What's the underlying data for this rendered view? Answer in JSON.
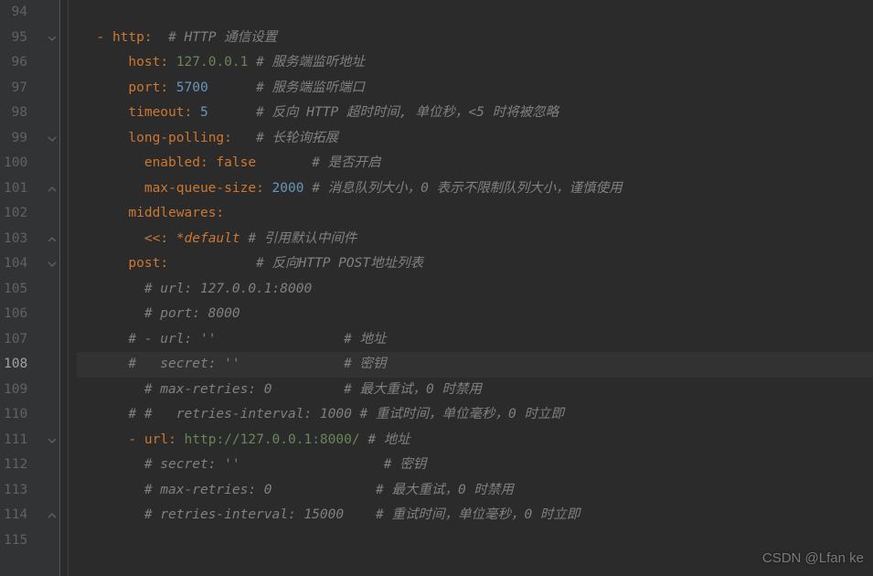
{
  "startLine": 94,
  "currentLine": 108,
  "watermark": "CSDN @Lfan ke",
  "lines": [
    {
      "num": 94,
      "tokens": []
    },
    {
      "num": 95,
      "fold": "down",
      "tokens": [
        {
          "t": "plain",
          "v": "  "
        },
        {
          "t": "dash",
          "v": "- "
        },
        {
          "t": "key",
          "v": "http"
        },
        {
          "t": "punct",
          "v": ":"
        },
        {
          "t": "plain",
          "v": "  "
        },
        {
          "t": "comment",
          "v": "# HTTP 通信设置"
        }
      ]
    },
    {
      "num": 96,
      "tokens": [
        {
          "t": "plain",
          "v": "      "
        },
        {
          "t": "key",
          "v": "host"
        },
        {
          "t": "punct",
          "v": ":"
        },
        {
          "t": "plain",
          "v": " "
        },
        {
          "t": "string",
          "v": "127.0.0.1"
        },
        {
          "t": "plain",
          "v": " "
        },
        {
          "t": "comment",
          "v": "# 服务端监听地址"
        }
      ]
    },
    {
      "num": 97,
      "tokens": [
        {
          "t": "plain",
          "v": "      "
        },
        {
          "t": "key",
          "v": "port"
        },
        {
          "t": "punct",
          "v": ":"
        },
        {
          "t": "plain",
          "v": " "
        },
        {
          "t": "number",
          "v": "5700"
        },
        {
          "t": "plain",
          "v": "      "
        },
        {
          "t": "comment",
          "v": "# 服务端监听端口"
        }
      ]
    },
    {
      "num": 98,
      "tokens": [
        {
          "t": "plain",
          "v": "      "
        },
        {
          "t": "key",
          "v": "timeout"
        },
        {
          "t": "punct",
          "v": ":"
        },
        {
          "t": "plain",
          "v": " "
        },
        {
          "t": "number",
          "v": "5"
        },
        {
          "t": "plain",
          "v": "      "
        },
        {
          "t": "comment",
          "v": "# 反向 HTTP 超时时间, 单位秒，<5 时将被忽略"
        }
      ]
    },
    {
      "num": 99,
      "fold": "down",
      "tokens": [
        {
          "t": "plain",
          "v": "      "
        },
        {
          "t": "key",
          "v": "long-polling"
        },
        {
          "t": "punct",
          "v": ":"
        },
        {
          "t": "plain",
          "v": "   "
        },
        {
          "t": "comment",
          "v": "# 长轮询拓展"
        }
      ]
    },
    {
      "num": 100,
      "tokens": [
        {
          "t": "plain",
          "v": "        "
        },
        {
          "t": "key",
          "v": "enabled"
        },
        {
          "t": "punct",
          "v": ":"
        },
        {
          "t": "plain",
          "v": " "
        },
        {
          "t": "bool",
          "v": "false"
        },
        {
          "t": "plain",
          "v": "       "
        },
        {
          "t": "comment",
          "v": "# 是否开启"
        }
      ]
    },
    {
      "num": 101,
      "fold": "up",
      "tokens": [
        {
          "t": "plain",
          "v": "        "
        },
        {
          "t": "key",
          "v": "max-queue-size"
        },
        {
          "t": "punct",
          "v": ":"
        },
        {
          "t": "plain",
          "v": " "
        },
        {
          "t": "number",
          "v": "2000"
        },
        {
          "t": "plain",
          "v": " "
        },
        {
          "t": "comment",
          "v": "# 消息队列大小，0 表示不限制队列大小，谨慎使用"
        }
      ]
    },
    {
      "num": 102,
      "tokens": [
        {
          "t": "plain",
          "v": "      "
        },
        {
          "t": "key",
          "v": "middlewares"
        },
        {
          "t": "punct",
          "v": ":"
        }
      ]
    },
    {
      "num": 103,
      "fold": "up",
      "tokens": [
        {
          "t": "plain",
          "v": "        "
        },
        {
          "t": "key",
          "v": "<<"
        },
        {
          "t": "punct",
          "v": ":"
        },
        {
          "t": "plain",
          "v": " "
        },
        {
          "t": "anchor",
          "v": "*default"
        },
        {
          "t": "plain",
          "v": " "
        },
        {
          "t": "comment",
          "v": "# 引用默认中间件"
        }
      ]
    },
    {
      "num": 104,
      "fold": "down",
      "tokens": [
        {
          "t": "plain",
          "v": "      "
        },
        {
          "t": "key",
          "v": "post"
        },
        {
          "t": "punct",
          "v": ":"
        },
        {
          "t": "plain",
          "v": "           "
        },
        {
          "t": "comment",
          "v": "# 反向HTTP POST地址列表"
        }
      ]
    },
    {
      "num": 105,
      "tokens": [
        {
          "t": "plain",
          "v": "        "
        },
        {
          "t": "comment",
          "v": "# url: 127.0.0.1:8000"
        }
      ]
    },
    {
      "num": 106,
      "tokens": [
        {
          "t": "plain",
          "v": "        "
        },
        {
          "t": "comment",
          "v": "# port: 8000"
        }
      ]
    },
    {
      "num": 107,
      "tokens": [
        {
          "t": "plain",
          "v": "      "
        },
        {
          "t": "comment",
          "v": "# - url: ''                # 地址"
        }
      ]
    },
    {
      "num": 108,
      "tokens": [
        {
          "t": "plain",
          "v": "      "
        },
        {
          "t": "comment",
          "v": "#   secret: ''             # 密钥"
        }
      ]
    },
    {
      "num": 109,
      "tokens": [
        {
          "t": "plain",
          "v": "        "
        },
        {
          "t": "comment",
          "v": "# max-retries: 0         # 最大重试，0 时禁用"
        }
      ]
    },
    {
      "num": 110,
      "tokens": [
        {
          "t": "plain",
          "v": "      "
        },
        {
          "t": "comment",
          "v": "# #   retries-interval: 1000 # 重试时间，单位毫秒，0 时立即"
        }
      ]
    },
    {
      "num": 111,
      "fold": "down",
      "tokens": [
        {
          "t": "plain",
          "v": "      "
        },
        {
          "t": "dash",
          "v": "- "
        },
        {
          "t": "key",
          "v": "url"
        },
        {
          "t": "punct",
          "v": ":"
        },
        {
          "t": "plain",
          "v": " "
        },
        {
          "t": "string",
          "v": "http://127.0.0.1:8000/"
        },
        {
          "t": "plain",
          "v": " "
        },
        {
          "t": "comment",
          "v": "# 地址"
        }
      ]
    },
    {
      "num": 112,
      "tokens": [
        {
          "t": "plain",
          "v": "        "
        },
        {
          "t": "comment",
          "v": "# secret: ''                  # 密钥"
        }
      ]
    },
    {
      "num": 113,
      "tokens": [
        {
          "t": "plain",
          "v": "        "
        },
        {
          "t": "comment",
          "v": "# max-retries: 0             # 最大重试，0 时禁用"
        }
      ]
    },
    {
      "num": 114,
      "fold": "up",
      "tokens": [
        {
          "t": "plain",
          "v": "        "
        },
        {
          "t": "comment",
          "v": "# retries-interval: 15000    # 重试时间，单位毫秒，0 时立即"
        }
      ]
    },
    {
      "num": 115,
      "tokens": []
    }
  ]
}
